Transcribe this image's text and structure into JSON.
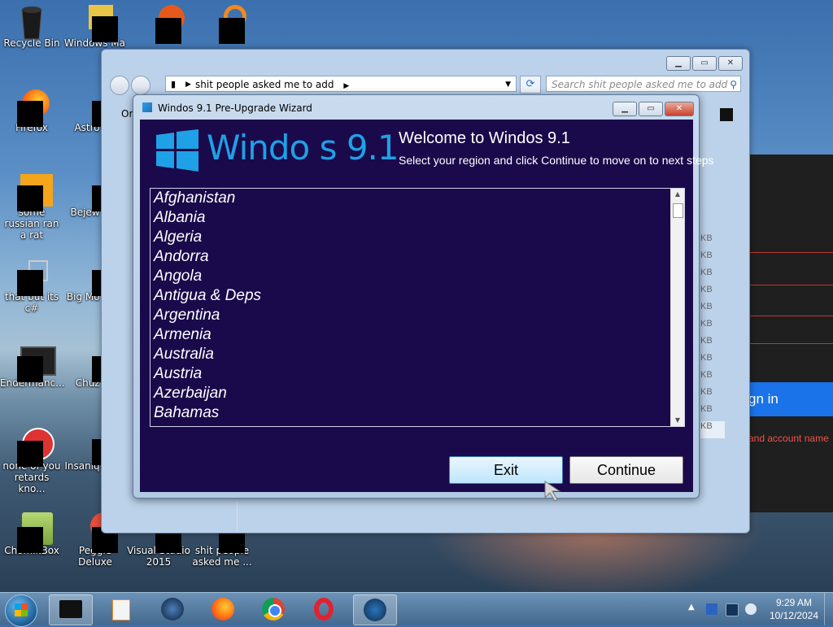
{
  "desktop": {
    "icons": [
      {
        "label": "Recycle Bin"
      },
      {
        "label": "Windows Ma"
      },
      {
        "label": "Firefox"
      },
      {
        "label": "Astro Delu"
      },
      {
        "label": "some russian ran a rat"
      },
      {
        "label": "Bejew Delu"
      },
      {
        "label": "that but its c#"
      },
      {
        "label": "Big Mo Delu"
      },
      {
        "label": "Endermanc..."
      },
      {
        "label": "Chuz Delu"
      },
      {
        "label": "none of you retards kno..."
      },
      {
        "label": "Insaniq Delu"
      },
      {
        "label": "ChomikBox"
      },
      {
        "label": "Peggle Deluxe"
      },
      {
        "label": "Visual Studio 2015"
      },
      {
        "label": "shit people asked me ..."
      }
    ]
  },
  "background_page": {
    "signin_text": "gn in",
    "error_text": "and account name"
  },
  "explorer": {
    "address": "shit people asked me to add",
    "search_placeholder": "Search shit people asked me to add",
    "organize_label": "Or",
    "sizes": [
      "KB",
      "KB",
      "KB",
      "KB",
      "KB",
      "KB",
      "KB",
      "KB",
      "KB",
      "KB",
      "KB",
      "KB"
    ]
  },
  "wizard": {
    "title": "Windos 9.1 Pre-Upgrade Wizard",
    "logo_text": "Windo  s 9.1",
    "heading": "Welcome to Windos 9.1",
    "subheading": "Select your region and click Continue to move on to next steps",
    "countries": [
      "Afghanistan",
      "Albania",
      "Algeria",
      "Andorra",
      "Angola",
      "Antigua & Deps",
      "Argentina",
      "Armenia",
      "Australia",
      "Austria",
      "Azerbaijan",
      "Bahamas"
    ],
    "exit_label": "Exit",
    "continue_label": "Continue"
  },
  "taskbar": {
    "time": "9:29 AM",
    "date": "10/12/2024"
  }
}
